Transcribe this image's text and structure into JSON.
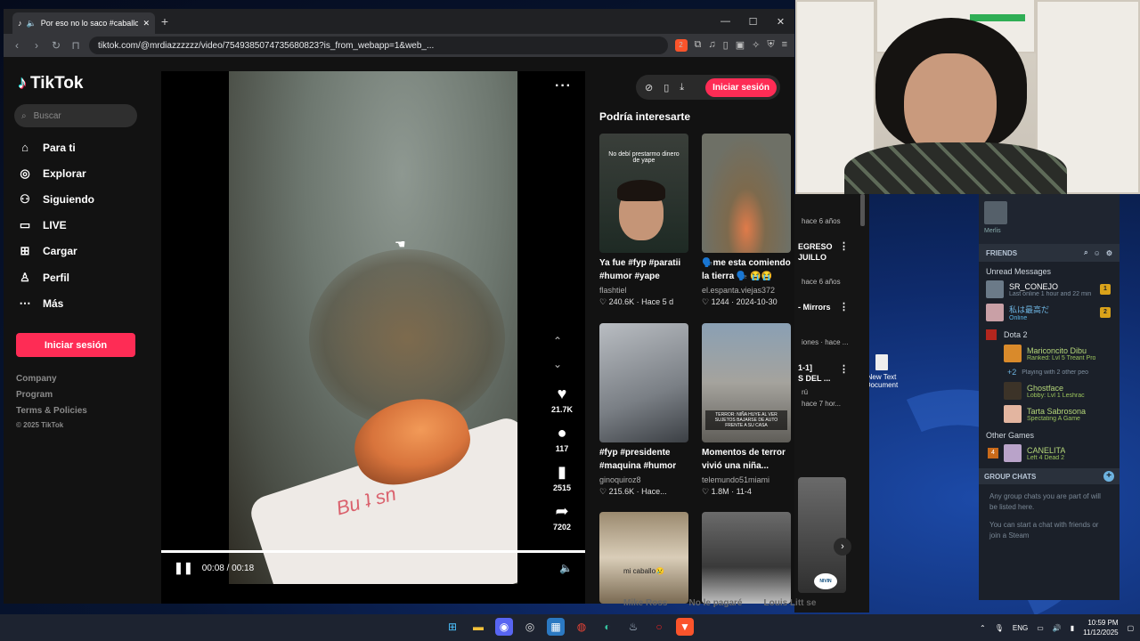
{
  "browser": {
    "tab_title": "Por eso no lo saco #caballo",
    "url": "tiktok.com/@mrdiazzzzzz/video/7549385074735680823?is_from_webapp=1&web_...",
    "new_tab": "+",
    "ext_badge": "2"
  },
  "sidebar": {
    "logo": "TikTok",
    "search_placeholder": "Buscar",
    "nav": [
      {
        "label": "Para ti",
        "icon": "home-icon"
      },
      {
        "label": "Explorar",
        "icon": "compass-icon"
      },
      {
        "label": "Siguiendo",
        "icon": "following-icon"
      },
      {
        "label": "LIVE",
        "icon": "live-icon"
      },
      {
        "label": "Cargar",
        "icon": "upload-icon"
      },
      {
        "label": "Perfil",
        "icon": "profile-icon"
      },
      {
        "label": "Más",
        "icon": "more-icon"
      }
    ],
    "login": "Iniciar sesión",
    "footer": [
      "Company",
      "Program",
      "Terms & Policies"
    ],
    "copyright": "© 2025 TikTok"
  },
  "video": {
    "likes": "21.7K",
    "comments": "117",
    "saves": "2515",
    "shares": "7202",
    "time": "00:08 / 00:18",
    "author": "mrdiazzzzzz",
    "progress": 1.0
  },
  "header": {
    "login": "Iniciar sesión"
  },
  "recommendations": {
    "title": "Podría interesarte",
    "cards": [
      {
        "caption": "Ya fue #fyp #paratii #humor #yape",
        "author": "flashtiel",
        "likes": "240.6K",
        "age": "Hace 5 d",
        "thumb_text": "No debí prestarmo dinero de yape"
      },
      {
        "caption": "🗣️me esta comiendo la tierra 🗣️ 😭😭",
        "author": "el.espanta.viejas372",
        "likes": "1244",
        "age": "2024-10-30"
      },
      {
        "caption": "#fyp #presidente #maquina #humor",
        "author": "ginoquiroz8",
        "likes": "215.6K",
        "age": "Hace..."
      },
      {
        "caption": "Momentos de terror vivió una niña...",
        "author": "telemundo51miami",
        "likes": "1.8M",
        "age": "11-4",
        "thumb_text": "TERROR: NIÑA HUYE AL VER SUJETOS BAJARSE DE AUTO FRENTE A SU CASA"
      },
      {
        "caption": "",
        "author": "",
        "likes": "",
        "age": "",
        "thumb_text": "mi caballo😢"
      },
      {
        "caption": "",
        "author": "",
        "likes": "",
        "age": ""
      }
    ],
    "bottom_chips": [
      "Mike Ross",
      "No le pagaré",
      "Louis Litt se"
    ]
  },
  "side_strip": {
    "lines": [
      "hace 6 años",
      "EGRESO",
      "JUILLO",
      "hace 6 años",
      "- Mirrors",
      "iones · hace ...",
      "1-1]",
      "S DEL ...",
      "rú",
      "hace 7 hor..."
    ],
    "thumb_label": "NIVIN"
  },
  "desktop": {
    "icon_label": "New Text Document"
  },
  "steam": {
    "user": "Merlis",
    "friends_label": "FRIENDS",
    "unread_label": "Unread Messages",
    "unread": [
      {
        "name": "SR_CONEJO",
        "status": "Last online 1 hour and 22 min",
        "count": "1"
      },
      {
        "name": "私は最高だ",
        "status": "Online",
        "count": "2"
      }
    ],
    "game": "Dota 2",
    "players": [
      {
        "name": "Mariconcito Dibu",
        "status": "Ranked: Lvl 5 Treant Pro"
      },
      {
        "name": "Ghostface",
        "status": "Lobby: Lvl 1 Leshrac"
      },
      {
        "name": "Tarta Sabrosona",
        "status": "Spectating A Game"
      }
    ],
    "others_note": "+2",
    "others_text": "Playing with 2 other peo",
    "other_games_label": "Other Games",
    "other_player": {
      "name": "CANELITA",
      "status": "Left 4 Dead 2",
      "count": "4"
    },
    "group_chats": "GROUP CHATS",
    "group_text_1": "Any group chats you are part of will be listed here.",
    "group_text_2": "You can start a chat with friends or join a Steam"
  },
  "taskbar": {
    "lang": "ENG",
    "time": "10:59 PM",
    "date": "11/12/2025"
  }
}
